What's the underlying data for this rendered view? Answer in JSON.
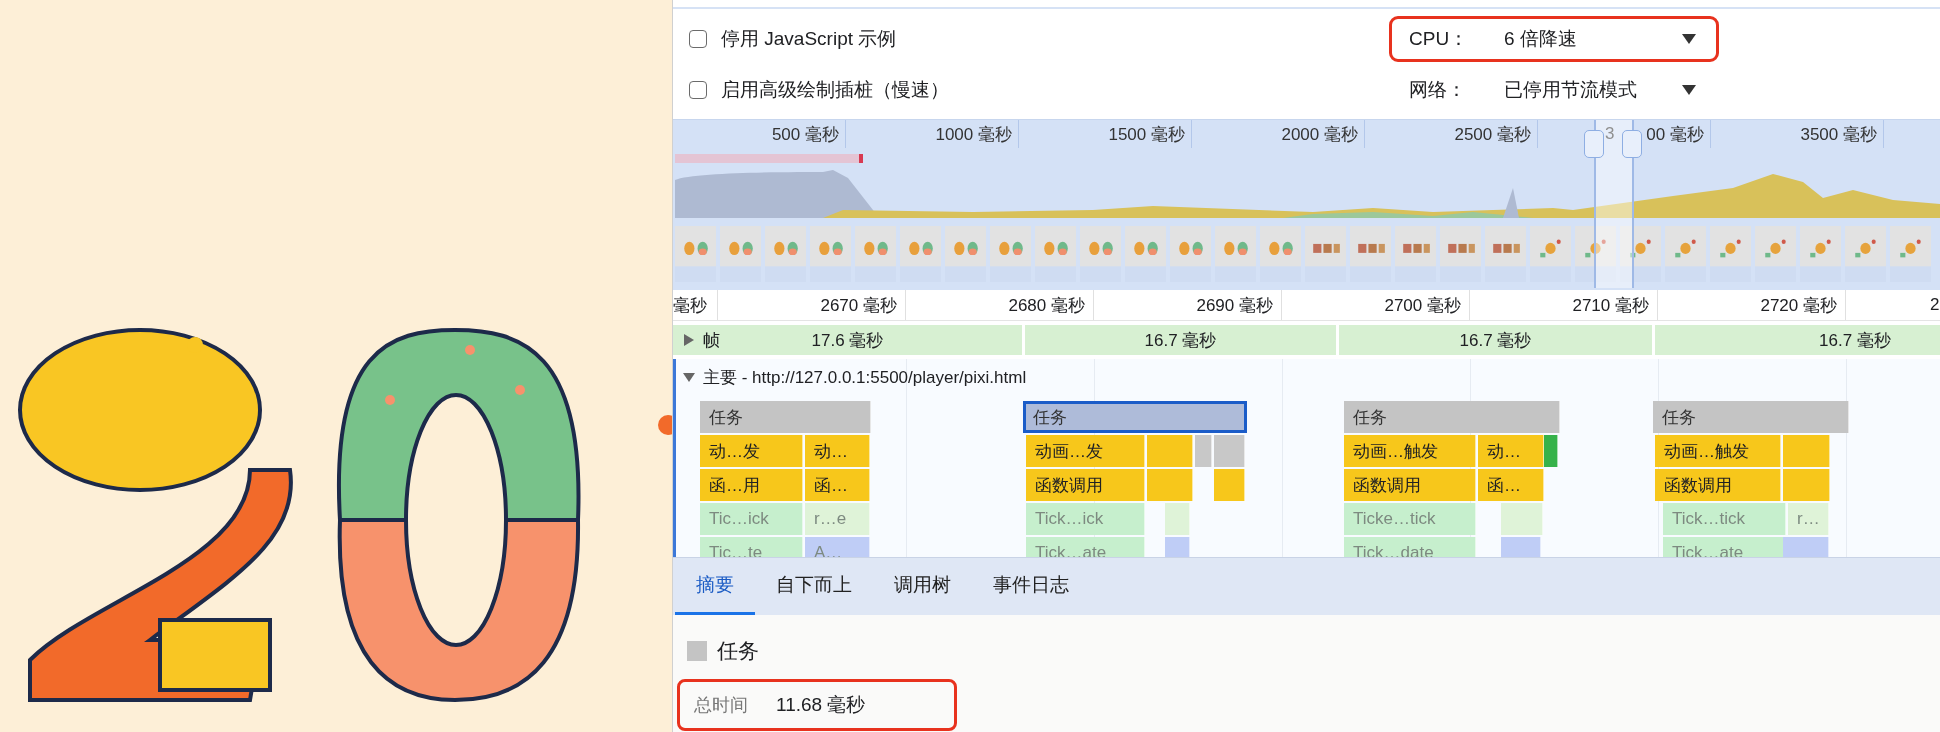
{
  "settings": [
    {
      "checkbox": {
        "label": "停用 JavaScript 示例",
        "checked": false
      },
      "dropdown": {
        "label": "CPU：",
        "value": "6 倍降速",
        "highlighted": true
      }
    },
    {
      "checkbox": {
        "label": "启用高级绘制插桩（慢速）",
        "checked": false
      },
      "dropdown": {
        "label": "网络：",
        "value": "已停用节流模式",
        "highlighted": false
      }
    }
  ],
  "overview": {
    "ticks": [
      {
        "parts": [
          "500 毫秒"
        ]
      },
      {
        "parts": [
          "1000 毫秒"
        ]
      },
      {
        "parts": [
          "1500 毫秒"
        ]
      },
      {
        "parts": [
          "2000 毫秒"
        ]
      },
      {
        "parts": [
          "2500 毫秒"
        ]
      },
      {
        "parts": [
          "3",
          "00 毫秒"
        ]
      },
      {
        "parts": [
          "3500 毫秒"
        ]
      }
    ]
  },
  "ruler": [
    "毫秒",
    "2670 毫秒",
    "2680 毫秒",
    "2690 毫秒",
    "2700 毫秒",
    "2710 毫秒",
    "2720 毫秒",
    "2"
  ],
  "frames": {
    "label": "帧",
    "expanded": false,
    "durations": [
      "17.6 毫秒",
      "16.7 毫秒",
      "16.7 毫秒",
      "16.7 毫秒"
    ]
  },
  "main_track": {
    "label": "主要 - http://127.0.0.1:5500/player/pixi.html",
    "expanded": true
  },
  "tasks": [
    {
      "label": "任务",
      "selected": false,
      "rows": [
        [
          {
            "label": "动…发",
            "color": "#f7c71b"
          },
          {
            "label": "动…",
            "color": "#f7c71b"
          }
        ],
        [
          {
            "label": "函…用",
            "color": "#f7c71b"
          },
          {
            "label": "函…",
            "color": "#f7c71b"
          }
        ],
        [
          {
            "label": "Tic…ick",
            "color": "#c6efcd"
          },
          {
            "label": "r…e",
            "color": "#dff3d8"
          }
        ],
        [
          {
            "label": "Tic…te",
            "color": "#c6efcd"
          },
          {
            "label": "A…",
            "color": "#bfcdf6"
          }
        ]
      ]
    },
    {
      "label": "任务",
      "selected": true,
      "rows": [
        [
          {
            "label": "动画…发",
            "color": "#f7c71b"
          },
          {
            "color": "#f7c71b"
          },
          {
            "color": "#c8c8c8"
          },
          {
            "color": "#c8c8c8"
          }
        ],
        [
          {
            "label": "函数调用",
            "color": "#f7c71b"
          },
          {
            "color": "#f7c71b"
          },
          {
            "color": "#f7c71b"
          }
        ],
        [
          {
            "label": "Tick…ick",
            "color": "#c6efcd"
          },
          {
            "color": "#dff3d8"
          }
        ],
        [
          {
            "label": "Tick…ate",
            "color": "#c6efcd"
          },
          {
            "color": "#bfcdf6"
          }
        ]
      ]
    },
    {
      "label": "任务",
      "selected": false,
      "rows": [
        [
          {
            "label": "动画…触发",
            "color": "#f7c71b"
          },
          {
            "label": "动…",
            "color": "#f7c71b"
          },
          {
            "color": "#36b24a"
          }
        ],
        [
          {
            "label": "函数调用",
            "color": "#f7c71b"
          },
          {
            "label": "函…",
            "color": "#f7c71b"
          }
        ],
        [
          {
            "label": "Ticke…tick",
            "color": "#c6efcd"
          },
          {
            "color": "#dff3d8"
          }
        ],
        [
          {
            "label": "Tick…date",
            "color": "#c6efcd"
          },
          {
            "color": "#bfcdf6"
          }
        ]
      ]
    },
    {
      "label": "任务",
      "selected": false,
      "rows": [
        [
          {
            "label": "动画…触发",
            "color": "#f7c71b"
          },
          {
            "color": "#f7c71b"
          }
        ],
        [
          {
            "label": "函数调用",
            "color": "#f7c71b"
          },
          {
            "color": "#f7c71b"
          }
        ],
        [
          {
            "label": "Tick…tick",
            "color": "#c6efcd"
          },
          {
            "label": "r…",
            "color": "#dff3d8"
          }
        ],
        [
          {
            "label": "Tick…ate",
            "color": "#c6efcd"
          },
          {
            "color": "#bfcdf6"
          }
        ]
      ]
    }
  ],
  "tabs": [
    {
      "label": "摘要",
      "selected": true
    },
    {
      "label": "自下而上",
      "selected": false
    },
    {
      "label": "调用树",
      "selected": false
    },
    {
      "label": "事件日志",
      "selected": false
    }
  ],
  "summary": {
    "category": {
      "label": "任务",
      "color": "#c4c4c4"
    },
    "total": {
      "label": "总时间",
      "value": "11.68 毫秒",
      "highlighted": true
    }
  }
}
